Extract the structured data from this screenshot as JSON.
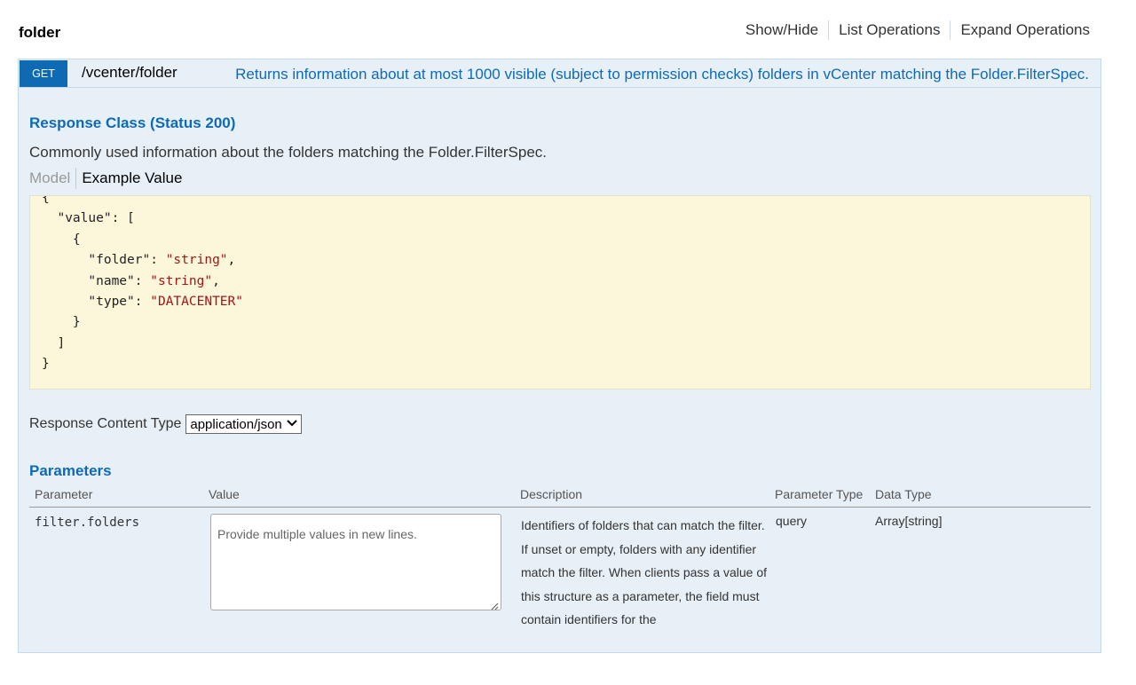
{
  "resource": {
    "title": "folder"
  },
  "top_links": {
    "show_hide": "Show/Hide",
    "list_operations": "List Operations",
    "expand_operations": "Expand Operations"
  },
  "operation": {
    "method": "GET",
    "path": "/vcenter/folder",
    "summary": "Returns information about at most 1000 visible (subject to permission checks) folders in vCenter matching the Folder.FilterSpec.",
    "response_class_title": "Response Class (Status 200)",
    "response_description": "Commonly used information about the folders matching the Folder.FilterSpec.",
    "tabs": {
      "model": "Model",
      "example": "Example Value"
    },
    "example_value": {
      "open": "{",
      "value_key": "\"value\": [",
      "obj_open": "{",
      "folder_key": "\"folder\": ",
      "folder_val": "\"string\"",
      "name_key": "\"name\": ",
      "name_val": "\"string\"",
      "type_key": "\"type\": ",
      "type_val": "\"DATACENTER\"",
      "obj_close": "}",
      "arr_close": "]",
      "close": "}"
    },
    "response_content_type": {
      "label": "Response Content Type",
      "selected": "application/json"
    },
    "parameters": {
      "title": "Parameters",
      "headers": {
        "parameter": "Parameter",
        "value": "Value",
        "description": "Description",
        "parameter_type": "Parameter Type",
        "data_type": "Data Type"
      },
      "rows": [
        {
          "name": "filter.folders",
          "placeholder": "Provide multiple values in new lines.",
          "description": "Identifiers of folders that can match the filter. If unset or empty, folders with any identifier match the filter. When clients pass a value of this structure as a parameter, the field must contain identifiers for the",
          "parameter_type": "query",
          "data_type": "Array[string]"
        }
      ]
    }
  },
  "colors": {
    "accent": "#0f6ab4",
    "operation_bg": "#e7f0f7",
    "example_bg": "#fcf6db",
    "string_value": "#a31515"
  }
}
